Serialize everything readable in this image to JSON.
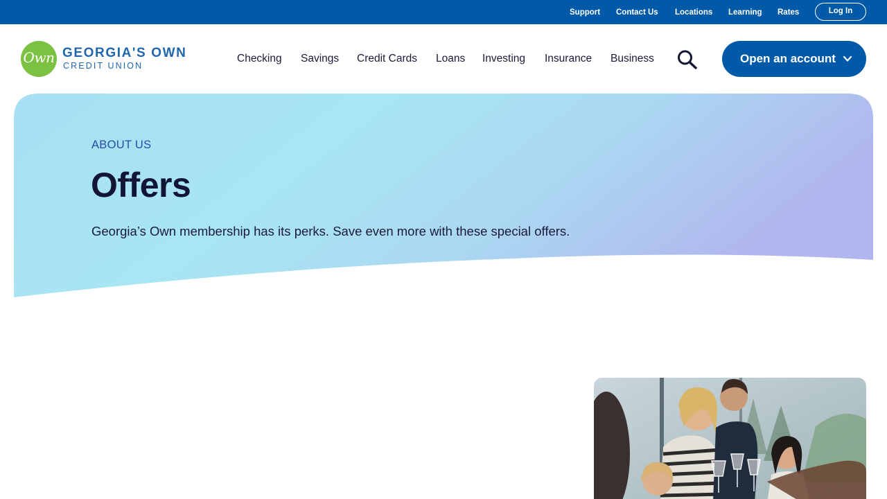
{
  "utility": {
    "links": [
      "Support",
      "Contact Us",
      "Locations",
      "Learning",
      "Rates"
    ],
    "login_label": "Log In"
  },
  "brand": {
    "logo_mark": "Own",
    "name": "GEORGIA'S OWN",
    "sub": "CREDIT UNION",
    "colors": {
      "primary": "#005aa7",
      "logo_green": "#7cc242"
    }
  },
  "nav": {
    "items": [
      "Checking",
      "Savings",
      "Credit Cards",
      "Loans",
      "Investing",
      "Insurance",
      "Business"
    ],
    "search_icon": "search-icon",
    "cta_label": "Open an account",
    "cta_icon": "chevron-down-icon"
  },
  "hero": {
    "eyebrow": "ABOUT US",
    "title": "Offers",
    "description": "Georgia’s Own membership has its perks. Save even more with these special offers."
  }
}
